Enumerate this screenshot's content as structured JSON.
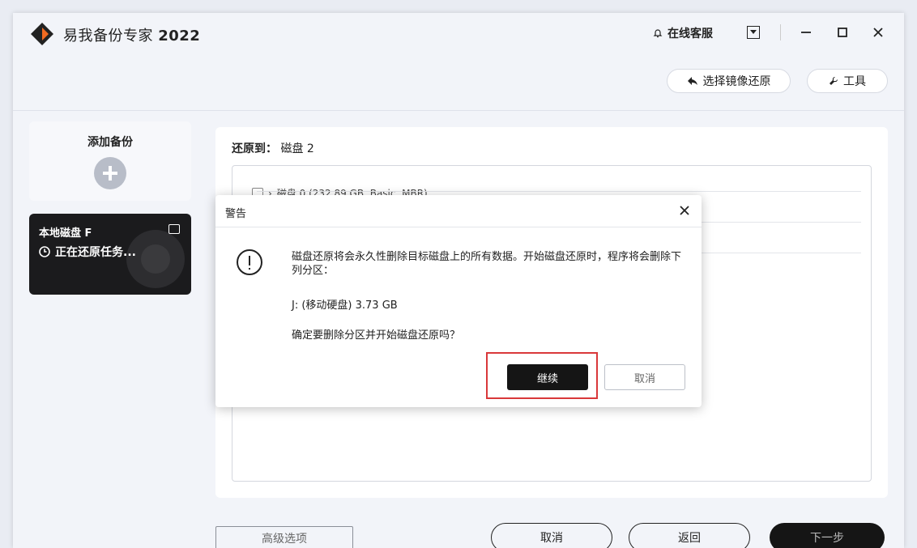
{
  "app": {
    "title_prefix": "易我备份专家",
    "title_year": "2022",
    "online_service": "在线客服",
    "select_image_restore": "选择镜像还原",
    "tools": "工具"
  },
  "sidebar": {
    "add_backup": "添加备份",
    "task_name": "本地磁盘 F",
    "task_status": "正在还原任务..."
  },
  "main": {
    "restore_to_label": "还原到：",
    "restore_to_value": "磁盘 2",
    "disk_row": "磁盘 0 (232.89 GB, Basic, MBR)"
  },
  "footer": {
    "advanced_options": "高级选项",
    "cancel": "取消",
    "back": "返回",
    "next": "下一步"
  },
  "dialog": {
    "title": "警告",
    "message": "磁盘还原将会永久性删除目标磁盘上的所有数据。开始磁盘还原时，程序将会删除下列分区：",
    "partition": "J: (移动硬盘) 3.73 GB",
    "confirm": "确定要删除分区并开始磁盘还原吗？",
    "continue_label": "继续",
    "cancel_label": "取消"
  },
  "colors": {
    "accent_orange": "#f26b21",
    "dark_button": "#151515",
    "highlight_red": "#d9383a"
  }
}
